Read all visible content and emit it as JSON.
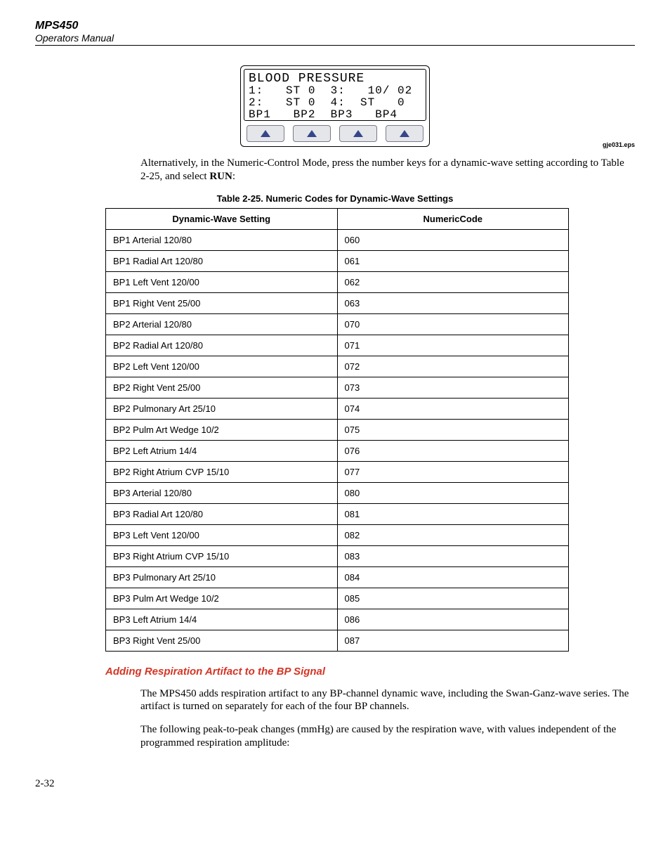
{
  "header": {
    "title": "MPS450",
    "subtitle": "Operators Manual"
  },
  "lcd": {
    "title": "BLOOD PRESSURE",
    "row1": "1:   ST 0  3:   10/ 02",
    "row2": "2:   ST 0  4:  ST   0",
    "row3": "BP1   BP2  BP3   BP4"
  },
  "eps_label": "gje031.eps",
  "para1_a": "Alternatively, in the Numeric-Control Mode, press the number keys for a dynamic-wave setting according to Table 2-25, and select ",
  "para1_run": "RUN",
  "para1_b": ":",
  "table_caption": "Table 2-25. Numeric Codes for Dynamic-Wave Settings",
  "table_headers": {
    "c1": "Dynamic-Wave Setting",
    "c2": "NumericCode"
  },
  "rows": [
    {
      "s": "BP1 Arterial 120/80",
      "c": "060"
    },
    {
      "s": "BP1 Radial Art 120/80",
      "c": "061"
    },
    {
      "s": "BP1 Left Vent 120/00",
      "c": "062"
    },
    {
      "s": "BP1 Right Vent 25/00",
      "c": "063"
    },
    {
      "s": "BP2 Arterial 120/80",
      "c": "070"
    },
    {
      "s": "BP2 Radial Art 120/80",
      "c": "071"
    },
    {
      "s": "BP2 Left Vent 120/00",
      "c": "072"
    },
    {
      "s": "BP2 Right Vent 25/00",
      "c": "073"
    },
    {
      "s": "BP2 Pulmonary Art 25/10",
      "c": "074"
    },
    {
      "s": "BP2 Pulm Art Wedge 10/2",
      "c": "075"
    },
    {
      "s": "BP2 Left Atrium 14/4",
      "c": "076"
    },
    {
      "s": "BP2 Right Atrium CVP 15/10",
      "c": "077"
    },
    {
      "s": "BP3 Arterial 120/80",
      "c": "080"
    },
    {
      "s": "BP3 Radial Art 120/80",
      "c": "081"
    },
    {
      "s": "BP3 Left Vent 120/00",
      "c": "082"
    },
    {
      "s": "BP3 Right Atrium CVP 15/10",
      "c": "083"
    },
    {
      "s": "BP3 Pulmonary Art 25/10",
      "c": "084"
    },
    {
      "s": "BP3 Pulm Art Wedge 10/2",
      "c": "085"
    },
    {
      "s": "BP3 Left Atrium 14/4",
      "c": "086"
    },
    {
      "s": "BP3 Right Vent 25/00",
      "c": "087"
    }
  ],
  "section_heading": "Adding Respiration Artifact to the BP Signal",
  "para2": "The MPS450 adds respiration artifact to any BP-channel dynamic wave, including the Swan-Ganz-wave series. The artifact is turned on separately for each of the four BP channels.",
  "para3": "The following peak-to-peak changes (mmHg) are caused by the respiration wave, with values independent of the programmed respiration amplitude:",
  "page_num": "2-32"
}
